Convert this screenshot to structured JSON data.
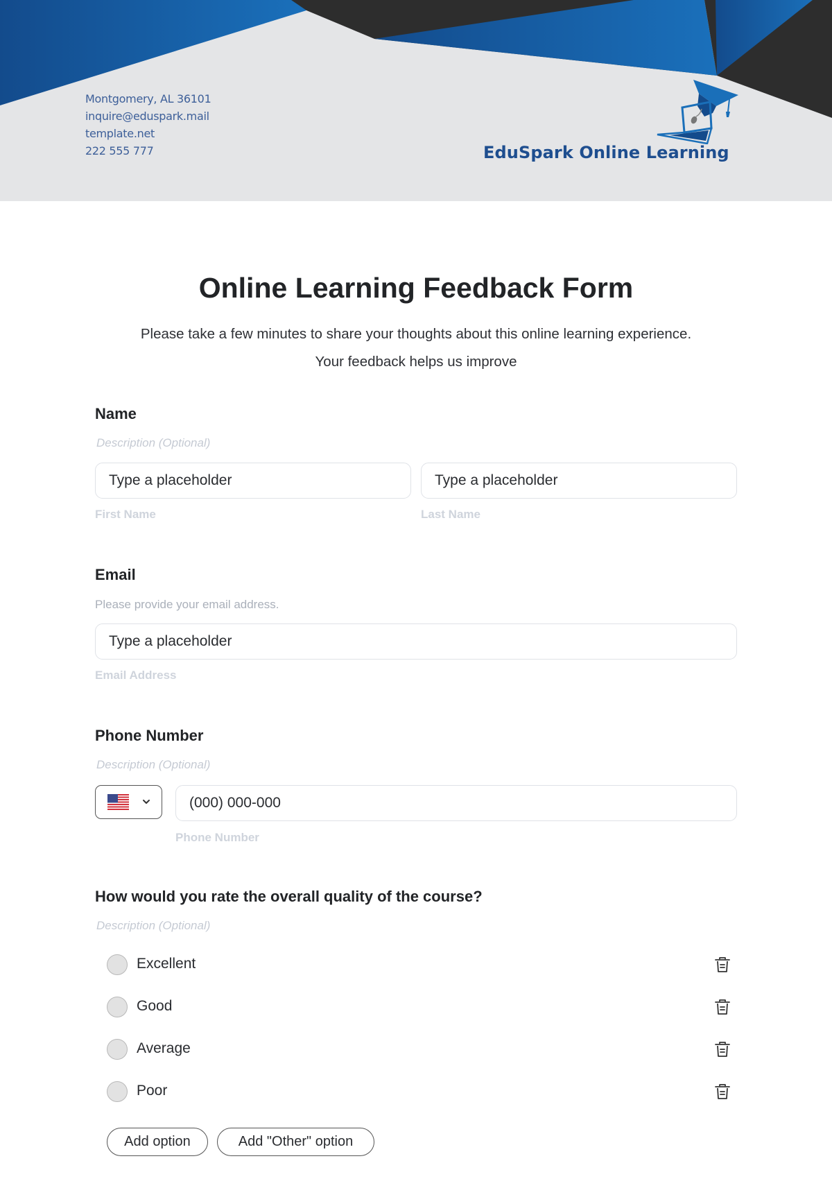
{
  "header": {
    "contact": {
      "address": "Montgomery, AL 36101",
      "email": "inquire@eduspark.mail",
      "website": "template.net",
      "phone": "222 555 777"
    },
    "brand": "EduSpark Online Learning",
    "logo_icon": "laptop-graduation-cap-icon",
    "colors": {
      "blue_dark": "#134b8c",
      "blue_light": "#1a70bb",
      "charcoal": "#2d2d2d",
      "band_bg": "#e4e5e7",
      "brand_text": "#1e4e8f"
    }
  },
  "form": {
    "title": "Online Learning Feedback Form",
    "subtitle_line1": "Please take a few minutes to share your thoughts about this online learning experience.",
    "subtitle_line2": "Your feedback helps us improve",
    "name": {
      "label": "Name",
      "description": "Description (Optional)",
      "first": {
        "placeholder": "Type a placeholder",
        "helper": "First Name"
      },
      "last": {
        "placeholder": "Type a placeholder",
        "helper": "Last Name"
      }
    },
    "email": {
      "label": "Email",
      "description": "Please provide your email address.",
      "placeholder": "Type a placeholder",
      "helper": "Email Address"
    },
    "phone": {
      "label": "Phone Number",
      "description": "Description (Optional)",
      "country_icon": "us-flag-icon",
      "placeholder": "(000) 000-000",
      "helper": "Phone Number"
    },
    "rating": {
      "question": "How would you rate the overall quality of the course?",
      "description": "Description (Optional)",
      "options": [
        {
          "label": "Excellent"
        },
        {
          "label": "Good"
        },
        {
          "label": "Average"
        },
        {
          "label": "Poor"
        }
      ],
      "add_option": "Add option",
      "add_other_option": "Add \"Other\" option"
    }
  }
}
